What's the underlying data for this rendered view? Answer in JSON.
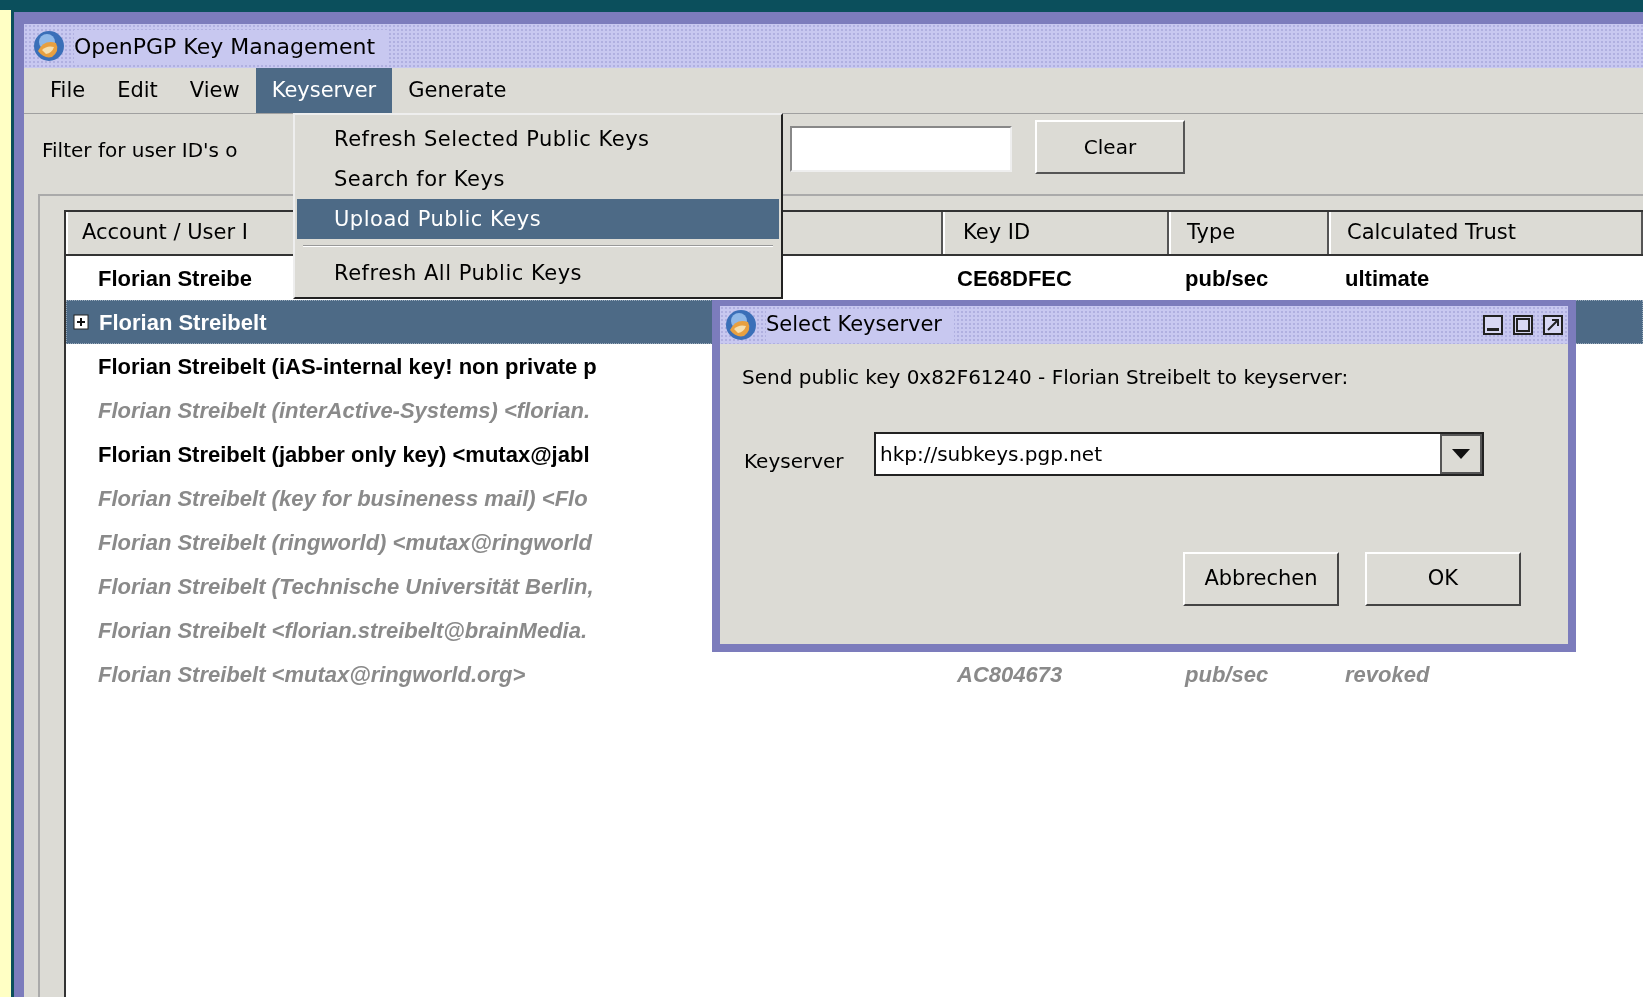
{
  "window": {
    "title": "OpenPGP Key Management"
  },
  "menu_bar": [
    {
      "label": "File",
      "selected": false
    },
    {
      "label": "Edit",
      "selected": false
    },
    {
      "label": "View",
      "selected": false
    },
    {
      "label": "Keyserver",
      "selected": true
    },
    {
      "label": "Generate",
      "selected": false
    }
  ],
  "menu": {
    "items": [
      {
        "kind": "item",
        "label": "Refresh Selected Public Keys",
        "selected": false
      },
      {
        "kind": "item",
        "label": "Search for Keys",
        "selected": false
      },
      {
        "kind": "item",
        "label": "Upload Public Keys",
        "selected": true
      },
      {
        "kind": "separator"
      },
      {
        "kind": "item",
        "label": "Refresh All Public Keys",
        "selected": false
      }
    ]
  },
  "filter": {
    "label": "Filter for user ID's o",
    "button": "Clear"
  },
  "table": {
    "columns": [
      "Account / User I",
      "Key ID",
      "Type",
      "Calculated Trust"
    ],
    "rows": [
      {
        "user_id": "Florian Streibe",
        "key_id": "CE68DFEC",
        "type": "pub/sec",
        "trust": "ultimate",
        "inactive": false,
        "selected": false
      },
      {
        "user_id": "Florian Streibelt",
        "inactive": false,
        "selected": true,
        "expanded": false
      },
      {
        "user_id": "Florian Streibelt (iAS-internal key! non private p",
        "inactive": false,
        "selected": false
      },
      {
        "user_id": "Florian Streibelt (interActive-Systems) <florian.",
        "inactive": true,
        "selected": false
      },
      {
        "user_id": "Florian Streibelt (jabber only key) <mutax@jabl",
        "inactive": false,
        "selected": false
      },
      {
        "user_id": "Florian Streibelt (key for busineness mail) <Flo",
        "inactive": true,
        "selected": false
      },
      {
        "user_id": "Florian Streibelt (ringworld) <mutax@ringworld",
        "inactive": true,
        "selected": false
      },
      {
        "user_id": "Florian Streibelt (Technische Universität Berlin,",
        "inactive": true,
        "selected": false
      },
      {
        "user_id": "Florian Streibelt <florian.streibelt@brainMedia.",
        "inactive": true,
        "selected": false
      },
      {
        "user_id": "Florian Streibelt <mutax@ringworld.org>",
        "key_id": "AC804673",
        "type": "pub/sec",
        "trust": "revoked",
        "inactive": true,
        "selected": false
      }
    ]
  },
  "dialog": {
    "title": "Select Keyserver",
    "message": "Send public key 0x82F61240 - Florian Streibelt to keyserver:",
    "field_label": "Keyserver",
    "value": "hkp://subkeys.pgp.net",
    "buttons": [
      "Abbrechen",
      "OK"
    ]
  }
}
